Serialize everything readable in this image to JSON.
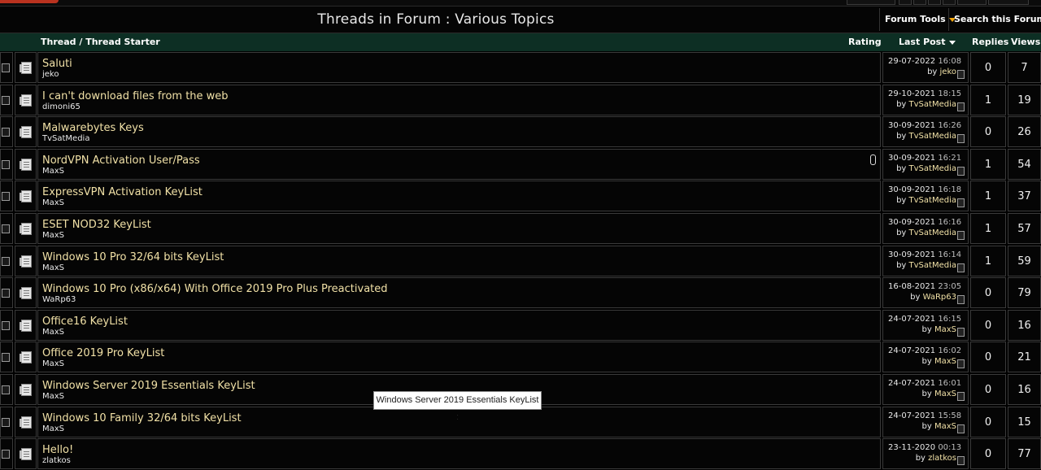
{
  "header": {
    "title": "Threads in Forum : Various Topics",
    "tools": [
      {
        "label": "Forum Tools"
      },
      {
        "label": "Search this Forum"
      }
    ]
  },
  "columns": {
    "thread": "Thread / Thread Starter",
    "rating": "Rating",
    "last_post": "Last Post",
    "replies": "Replies",
    "views": "Views"
  },
  "threads": [
    {
      "title": "Saluti",
      "starter": "jeko",
      "date": "29-07-2022",
      "time": "16:08",
      "by_label": "by",
      "by": "jeko",
      "replies": "0",
      "views": "7",
      "attachment": false
    },
    {
      "title": "I can't download files from the web",
      "starter": "dimoni65",
      "date": "29-10-2021",
      "time": "18:15",
      "by_label": "by",
      "by": "TvSatMedia",
      "replies": "1",
      "views": "19",
      "attachment": false
    },
    {
      "title": "Malwarebytes Keys",
      "starter": "TvSatMedia",
      "date": "30-09-2021",
      "time": "16:26",
      "by_label": "by",
      "by": "TvSatMedia",
      "replies": "0",
      "views": "26",
      "attachment": false
    },
    {
      "title": "NordVPN Activation User/Pass",
      "starter": "MaxS",
      "date": "30-09-2021",
      "time": "16:21",
      "by_label": "by",
      "by": "TvSatMedia",
      "replies": "1",
      "views": "54",
      "attachment": true
    },
    {
      "title": "ExpressVPN Activation KeyList",
      "starter": "MaxS",
      "date": "30-09-2021",
      "time": "16:18",
      "by_label": "by",
      "by": "TvSatMedia",
      "replies": "1",
      "views": "37",
      "attachment": false
    },
    {
      "title": "ESET NOD32 KeyList",
      "starter": "MaxS",
      "date": "30-09-2021",
      "time": "16:16",
      "by_label": "by",
      "by": "TvSatMedia",
      "replies": "1",
      "views": "57",
      "attachment": false
    },
    {
      "title": "Windows 10 Pro 32/64 bits KeyList",
      "starter": "MaxS",
      "date": "30-09-2021",
      "time": "16:14",
      "by_label": "by",
      "by": "TvSatMedia",
      "replies": "1",
      "views": "59",
      "attachment": false
    },
    {
      "title": "Windows 10 Pro (x86/x64) With Office 2019 Pro Plus Preactivated",
      "starter": "WaRp63",
      "date": "16-08-2021",
      "time": "23:05",
      "by_label": "by",
      "by": "WaRp63",
      "replies": "0",
      "views": "79",
      "attachment": false
    },
    {
      "title": "Office16 KeyList",
      "starter": "MaxS",
      "date": "24-07-2021",
      "time": "16:15",
      "by_label": "by",
      "by": "MaxS",
      "replies": "0",
      "views": "16",
      "attachment": false
    },
    {
      "title": "Office 2019 Pro KeyList",
      "starter": "MaxS",
      "date": "24-07-2021",
      "time": "16:02",
      "by_label": "by",
      "by": "MaxS",
      "replies": "0",
      "views": "21",
      "attachment": false
    },
    {
      "title": "Windows Server 2019 Essentials KeyList",
      "starter": "MaxS",
      "date": "24-07-2021",
      "time": "16:01",
      "by_label": "by",
      "by": "MaxS",
      "replies": "0",
      "views": "16",
      "attachment": false
    },
    {
      "title": "Windows 10 Family 32/64 bits KeyList",
      "starter": "MaxS",
      "date": "24-07-2021",
      "time": "15:58",
      "by_label": "by",
      "by": "MaxS",
      "replies": "0",
      "views": "15",
      "attachment": false
    },
    {
      "title": "Hello!",
      "starter": "zlatkos",
      "date": "23-11-2020",
      "time": "00:13",
      "by_label": "by",
      "by": "zlatkos",
      "replies": "0",
      "views": "77",
      "attachment": false
    }
  ],
  "tooltip": "Windows Server 2019 Essentials KeyList :",
  "colors": {
    "background": "#000000",
    "header_bar": "#0d2f24",
    "title_link": "#f0e0a6",
    "accent_caret": "#f0a30a"
  }
}
